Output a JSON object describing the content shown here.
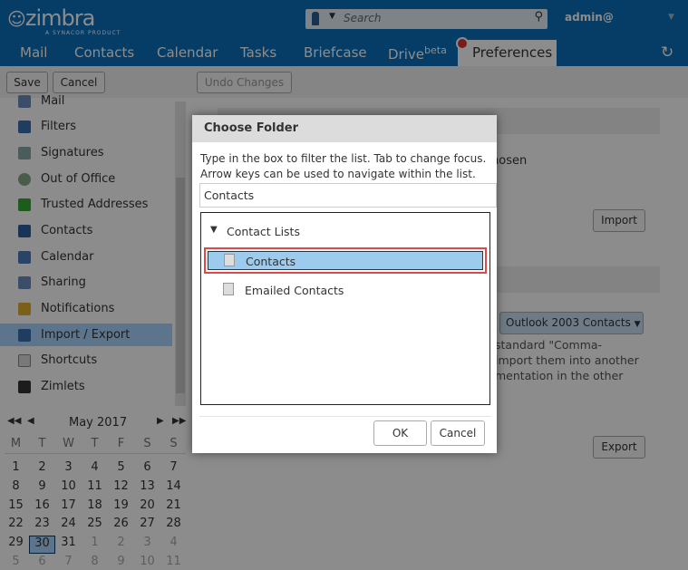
{
  "header": {
    "logo": "zimbra",
    "logo_sub": "A SYNACOR PRODUCT",
    "search_placeholder": "Search",
    "user": "admin@"
  },
  "nav": {
    "tabs": [
      "Mail",
      "Contacts",
      "Calendar",
      "Tasks",
      "Briefcase",
      "Drive",
      "Preferences"
    ],
    "drive_badge": "beta"
  },
  "toolbar": {
    "save": "Save",
    "cancel": "Cancel",
    "undo": "Undo Changes"
  },
  "sidebar": {
    "items": [
      "Mail",
      "Filters",
      "Signatures",
      "Out of Office",
      "Trusted Addresses",
      "Contacts",
      "Calendar",
      "Sharing",
      "Notifications",
      "Import / Export",
      "Shortcuts",
      "Zimlets"
    ],
    "selected": "Import / Export"
  },
  "calendar": {
    "month": "May 2017",
    "weekdays": [
      "M",
      "T",
      "W",
      "T",
      "F",
      "S",
      "S"
    ],
    "weeks": [
      [
        "1",
        "2",
        "3",
        "4",
        "5",
        "6",
        "7"
      ],
      [
        "8",
        "9",
        "10",
        "11",
        "12",
        "13",
        "14"
      ],
      [
        "15",
        "16",
        "17",
        "18",
        "19",
        "20",
        "21"
      ],
      [
        "22",
        "23",
        "24",
        "25",
        "26",
        "27",
        "28"
      ],
      [
        "29",
        "30",
        "31",
        "1",
        "2",
        "3",
        "4"
      ],
      [
        "5",
        "6",
        "7",
        "8",
        "9",
        "10",
        "11"
      ]
    ],
    "today": "30"
  },
  "main": {
    "text_chosen": "hosen",
    "import": "Import",
    "format_select": "Outlook 2003 Contacts",
    "desc_lines": [
      "standard \"Comma-",
      "import them into another",
      "mentation in the other"
    ],
    "export": "Export"
  },
  "dialog": {
    "title": "Choose Folder",
    "desc1": "Type in the box to filter the list. Tab to change focus.",
    "desc2": "Arrow keys can be used to navigate within the list.",
    "filter_value": "Contacts",
    "group": "Contact Lists",
    "items": [
      "Contacts",
      "Emailed Contacts"
    ],
    "ok": "OK",
    "cancel": "Cancel"
  },
  "colors": {
    "header": "#0a6fbc",
    "selection": "#9ccbed",
    "highlight_border": "#e04848"
  }
}
